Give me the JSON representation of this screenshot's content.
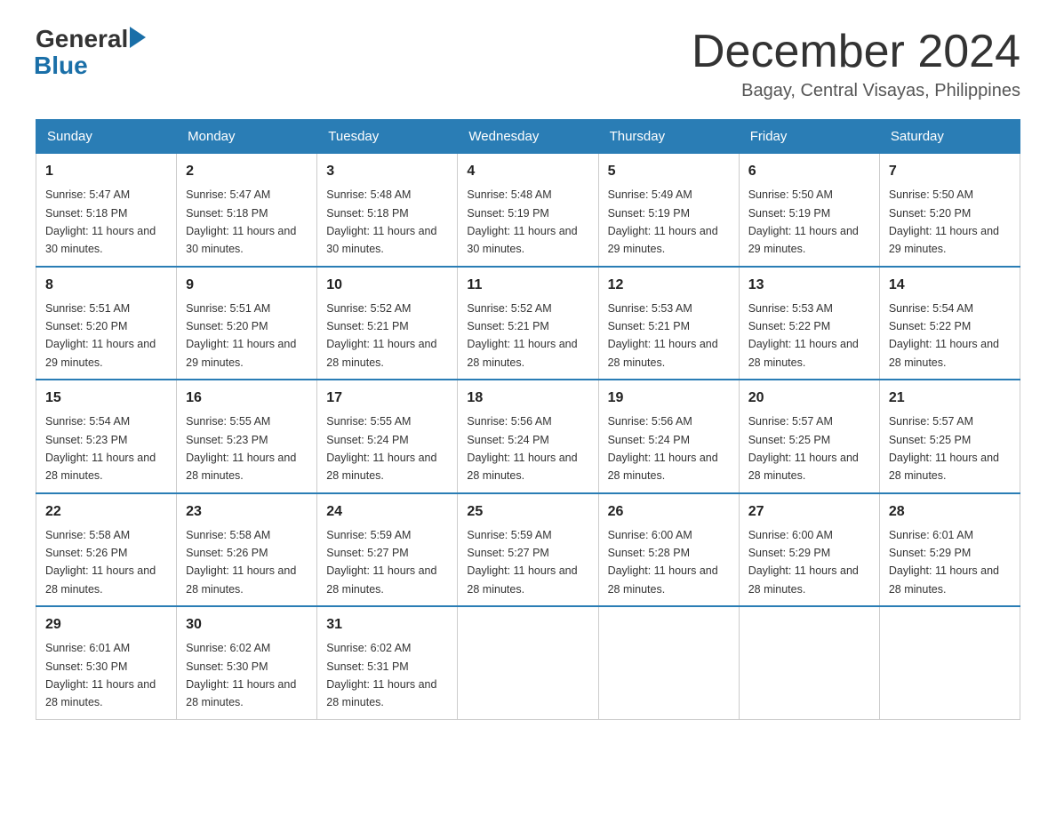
{
  "header": {
    "logo_general": "General",
    "logo_blue": "Blue",
    "title": "December 2024",
    "subtitle": "Bagay, Central Visayas, Philippines"
  },
  "days_of_week": [
    "Sunday",
    "Monday",
    "Tuesday",
    "Wednesday",
    "Thursday",
    "Friday",
    "Saturday"
  ],
  "weeks": [
    [
      {
        "day": "1",
        "sunrise": "5:47 AM",
        "sunset": "5:18 PM",
        "daylight": "11 hours and 30 minutes."
      },
      {
        "day": "2",
        "sunrise": "5:47 AM",
        "sunset": "5:18 PM",
        "daylight": "11 hours and 30 minutes."
      },
      {
        "day": "3",
        "sunrise": "5:48 AM",
        "sunset": "5:18 PM",
        "daylight": "11 hours and 30 minutes."
      },
      {
        "day": "4",
        "sunrise": "5:48 AM",
        "sunset": "5:19 PM",
        "daylight": "11 hours and 30 minutes."
      },
      {
        "day": "5",
        "sunrise": "5:49 AM",
        "sunset": "5:19 PM",
        "daylight": "11 hours and 29 minutes."
      },
      {
        "day": "6",
        "sunrise": "5:50 AM",
        "sunset": "5:19 PM",
        "daylight": "11 hours and 29 minutes."
      },
      {
        "day": "7",
        "sunrise": "5:50 AM",
        "sunset": "5:20 PM",
        "daylight": "11 hours and 29 minutes."
      }
    ],
    [
      {
        "day": "8",
        "sunrise": "5:51 AM",
        "sunset": "5:20 PM",
        "daylight": "11 hours and 29 minutes."
      },
      {
        "day": "9",
        "sunrise": "5:51 AM",
        "sunset": "5:20 PM",
        "daylight": "11 hours and 29 minutes."
      },
      {
        "day": "10",
        "sunrise": "5:52 AM",
        "sunset": "5:21 PM",
        "daylight": "11 hours and 28 minutes."
      },
      {
        "day": "11",
        "sunrise": "5:52 AM",
        "sunset": "5:21 PM",
        "daylight": "11 hours and 28 minutes."
      },
      {
        "day": "12",
        "sunrise": "5:53 AM",
        "sunset": "5:21 PM",
        "daylight": "11 hours and 28 minutes."
      },
      {
        "day": "13",
        "sunrise": "5:53 AM",
        "sunset": "5:22 PM",
        "daylight": "11 hours and 28 minutes."
      },
      {
        "day": "14",
        "sunrise": "5:54 AM",
        "sunset": "5:22 PM",
        "daylight": "11 hours and 28 minutes."
      }
    ],
    [
      {
        "day": "15",
        "sunrise": "5:54 AM",
        "sunset": "5:23 PM",
        "daylight": "11 hours and 28 minutes."
      },
      {
        "day": "16",
        "sunrise": "5:55 AM",
        "sunset": "5:23 PM",
        "daylight": "11 hours and 28 minutes."
      },
      {
        "day": "17",
        "sunrise": "5:55 AM",
        "sunset": "5:24 PM",
        "daylight": "11 hours and 28 minutes."
      },
      {
        "day": "18",
        "sunrise": "5:56 AM",
        "sunset": "5:24 PM",
        "daylight": "11 hours and 28 minutes."
      },
      {
        "day": "19",
        "sunrise": "5:56 AM",
        "sunset": "5:24 PM",
        "daylight": "11 hours and 28 minutes."
      },
      {
        "day": "20",
        "sunrise": "5:57 AM",
        "sunset": "5:25 PM",
        "daylight": "11 hours and 28 minutes."
      },
      {
        "day": "21",
        "sunrise": "5:57 AM",
        "sunset": "5:25 PM",
        "daylight": "11 hours and 28 minutes."
      }
    ],
    [
      {
        "day": "22",
        "sunrise": "5:58 AM",
        "sunset": "5:26 PM",
        "daylight": "11 hours and 28 minutes."
      },
      {
        "day": "23",
        "sunrise": "5:58 AM",
        "sunset": "5:26 PM",
        "daylight": "11 hours and 28 minutes."
      },
      {
        "day": "24",
        "sunrise": "5:59 AM",
        "sunset": "5:27 PM",
        "daylight": "11 hours and 28 minutes."
      },
      {
        "day": "25",
        "sunrise": "5:59 AM",
        "sunset": "5:27 PM",
        "daylight": "11 hours and 28 minutes."
      },
      {
        "day": "26",
        "sunrise": "6:00 AM",
        "sunset": "5:28 PM",
        "daylight": "11 hours and 28 minutes."
      },
      {
        "day": "27",
        "sunrise": "6:00 AM",
        "sunset": "5:29 PM",
        "daylight": "11 hours and 28 minutes."
      },
      {
        "day": "28",
        "sunrise": "6:01 AM",
        "sunset": "5:29 PM",
        "daylight": "11 hours and 28 minutes."
      }
    ],
    [
      {
        "day": "29",
        "sunrise": "6:01 AM",
        "sunset": "5:30 PM",
        "daylight": "11 hours and 28 minutes."
      },
      {
        "day": "30",
        "sunrise": "6:02 AM",
        "sunset": "5:30 PM",
        "daylight": "11 hours and 28 minutes."
      },
      {
        "day": "31",
        "sunrise": "6:02 AM",
        "sunset": "5:31 PM",
        "daylight": "11 hours and 28 minutes."
      },
      null,
      null,
      null,
      null
    ]
  ]
}
